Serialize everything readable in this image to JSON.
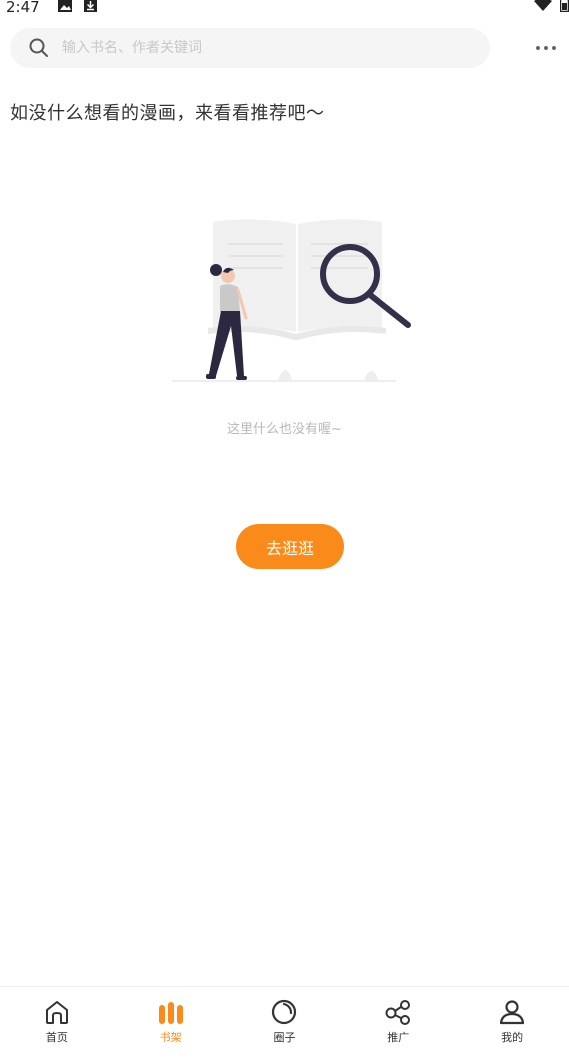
{
  "status_bar": {
    "time": "2:47"
  },
  "search": {
    "placeholder": "输入书名、作者关键词"
  },
  "header": {
    "more_icon": "more-dots-icon"
  },
  "prompt": "如没什么想看的漫画，来看看推荐吧～",
  "empty_state": {
    "illustration": "person-with-book-and-magnifier",
    "message": "这里什么也没有喔~",
    "button_label": "去逛逛"
  },
  "bottom_nav": {
    "items": [
      {
        "label": "首页",
        "icon": "home-icon",
        "active": false
      },
      {
        "label": "书架",
        "icon": "bookshelf-icon",
        "active": true
      },
      {
        "label": "圈子",
        "icon": "circle-icon",
        "active": false
      },
      {
        "label": "推广",
        "icon": "share-icon",
        "active": false
      },
      {
        "label": "我的",
        "icon": "profile-icon",
        "active": false
      }
    ]
  },
  "colors": {
    "accent": "#fa8a1a",
    "search_bg": "#f5f5f5",
    "muted_text": "#b8b8b8"
  }
}
